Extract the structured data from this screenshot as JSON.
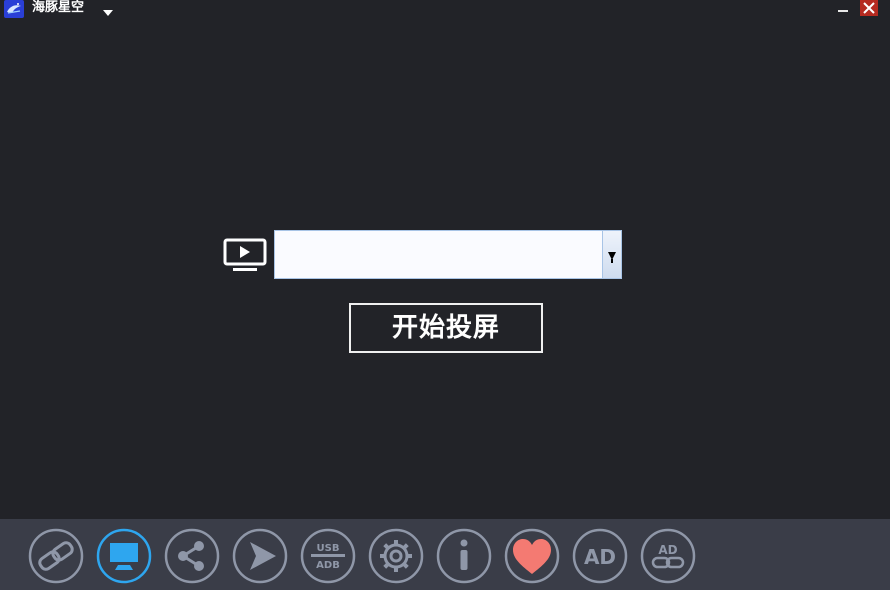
{
  "window": {
    "title": "海豚星空"
  },
  "colors": {
    "background": "#222328",
    "toolbar": "#3a3d48",
    "icon_gray": "#8f97a8",
    "icon_active": "#2ea6ef",
    "heart": "#f47a72",
    "close_button": "#b52a20"
  },
  "main": {
    "device_select": {
      "value": ""
    },
    "start_button_label": "开始投屏"
  },
  "toolbar": {
    "active_index": 1,
    "usb_adb": {
      "top": "USB",
      "bottom": "ADB"
    },
    "ad_label": "AD",
    "ad_link_label": "AD"
  }
}
